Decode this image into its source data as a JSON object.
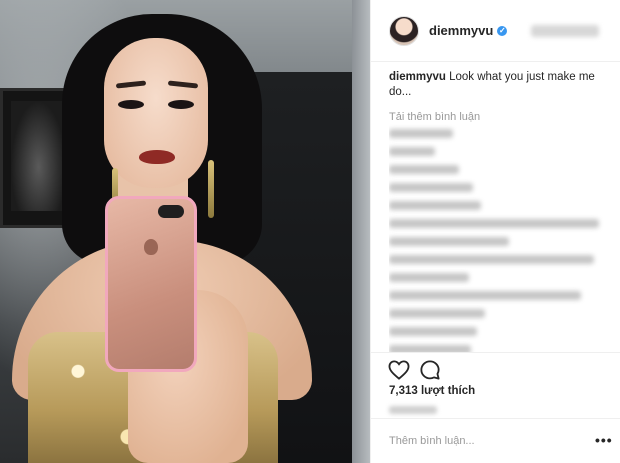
{
  "header": {
    "username": "diemmyvu"
  },
  "caption": {
    "username": "diemmyvu",
    "text": "Look what you just make me do..."
  },
  "comments": {
    "load_more": "Tải thêm bình luận"
  },
  "actions": {
    "likes_count": "7,313",
    "likes_label": "lượt thích"
  },
  "add_comment": {
    "placeholder": "Thêm bình luận..."
  },
  "icons": {
    "heart": "heart-icon",
    "comment": "comment-icon",
    "verified": "verified-badge-icon",
    "more": "more-options-icon"
  },
  "colors": {
    "verified_blue": "#3897f0",
    "muted_text": "#999999",
    "divider": "#efefef"
  }
}
